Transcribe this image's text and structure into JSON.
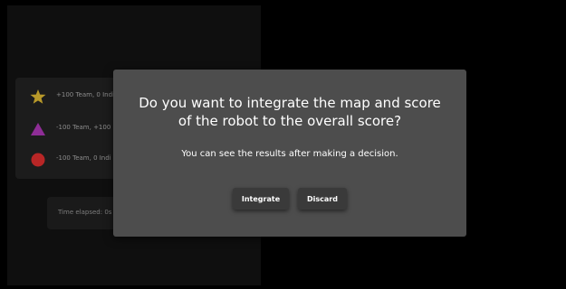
{
  "legend": {
    "items": [
      {
        "icon": "star-icon",
        "color": "#b8992a",
        "label": "+100 Team, 0 Indi"
      },
      {
        "icon": "triangle-icon",
        "color": "#8e2d96",
        "label": "-100 Team, +100 I"
      },
      {
        "icon": "circle-icon",
        "color": "#b82626",
        "label": "-100 Team, 0 Indi"
      }
    ]
  },
  "timer": {
    "label": "Time elapsed: 0s"
  },
  "dialog": {
    "title": "Do you want to integrate the map and score of the robot to the overall score?",
    "message": "You can see the results after making a decision.",
    "integrate_label": "Integrate",
    "discard_label": "Discard"
  }
}
